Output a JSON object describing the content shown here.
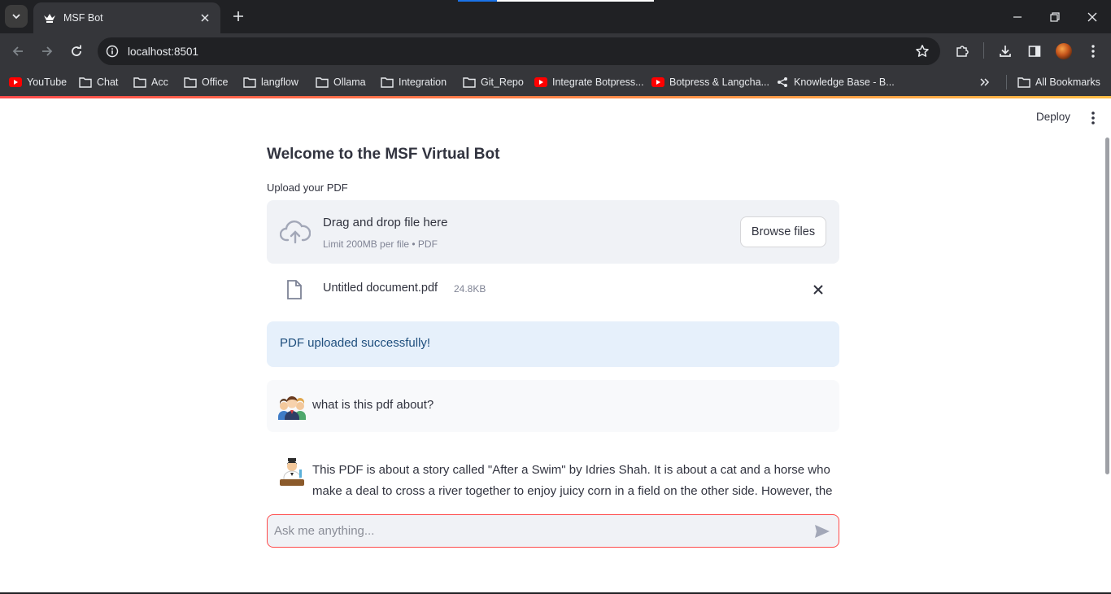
{
  "browser": {
    "tab": {
      "title": "MSF Bot",
      "favicon": "streamlit-crown-icon"
    },
    "address": {
      "url": "localhost:8501"
    },
    "bookmarks": [
      {
        "label": "YouTube",
        "icon": "youtube-icon"
      },
      {
        "label": "Chat",
        "icon": "folder-icon"
      },
      {
        "label": "Acc",
        "icon": "folder-icon"
      },
      {
        "label": "Office",
        "icon": "folder-icon"
      },
      {
        "label": "langflow",
        "icon": "folder-icon"
      },
      {
        "label": "Ollama",
        "icon": "folder-icon"
      },
      {
        "label": "Integration",
        "icon": "folder-icon"
      },
      {
        "label": "Git_Repo",
        "icon": "folder-icon"
      },
      {
        "label": "Integrate Botpress...",
        "icon": "youtube-icon"
      },
      {
        "label": "Botpress & Langcha...",
        "icon": "youtube-icon"
      },
      {
        "label": "Knowledge Base - B...",
        "icon": "share-icon"
      }
    ],
    "all_bookmarks": "All Bookmarks"
  },
  "app": {
    "deploy_label": "Deploy",
    "title": "Welcome to the MSF Virtual Bot",
    "upload": {
      "label": "Upload your PDF",
      "drop_title": "Drag and drop file here",
      "drop_subtitle": "Limit 200MB per file • PDF",
      "browse_label": "Browse files",
      "file": {
        "name": "Untitled document.pdf",
        "size": "24.8KB"
      }
    },
    "success_message": "PDF uploaded successfully!",
    "chat": [
      {
        "role": "user",
        "text": "what is this pdf about?"
      },
      {
        "role": "assistant",
        "text": "This PDF is about a story called \"After a Swim\" by Idries Shah. It is about a cat and a horse who make a deal to cross a river together to enjoy juicy corn in a field on the other side. However, the"
      }
    ],
    "input": {
      "placeholder": "Ask me anything..."
    }
  },
  "colors": {
    "primary": "#ff4b4b",
    "chrome_dark": "#202124",
    "chrome_mid": "#35363a",
    "text": "#31333f",
    "info_bg": "#e6f0fb",
    "info_text": "#1e4e7d"
  }
}
